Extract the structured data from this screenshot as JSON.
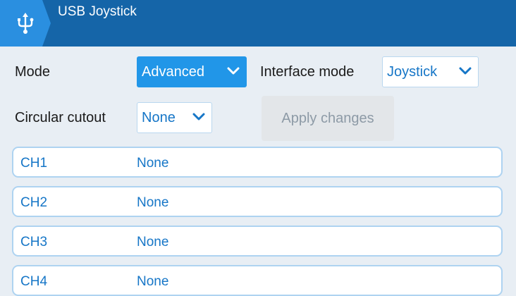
{
  "header": {
    "icon": "usb-icon",
    "title": "USB Joystick",
    "colors": {
      "bar": "#1565a8",
      "tab": "#2a8fe0"
    }
  },
  "settings": {
    "mode_label": "Mode",
    "mode_value": "Advanced",
    "interface_label": "Interface mode",
    "interface_value": "Joystick",
    "cutout_label": "Circular cutout",
    "cutout_value": "None",
    "apply_label": "Apply changes"
  },
  "channels": [
    {
      "name": "CH1",
      "value": "None"
    },
    {
      "name": "CH2",
      "value": "None"
    },
    {
      "name": "CH3",
      "value": "None"
    },
    {
      "name": "CH4",
      "value": "None"
    }
  ],
  "colors": {
    "accent": "#2196e8",
    "text_link": "#1676c7",
    "background": "#e8eef4",
    "disabled_button": "#e3e6e9"
  }
}
